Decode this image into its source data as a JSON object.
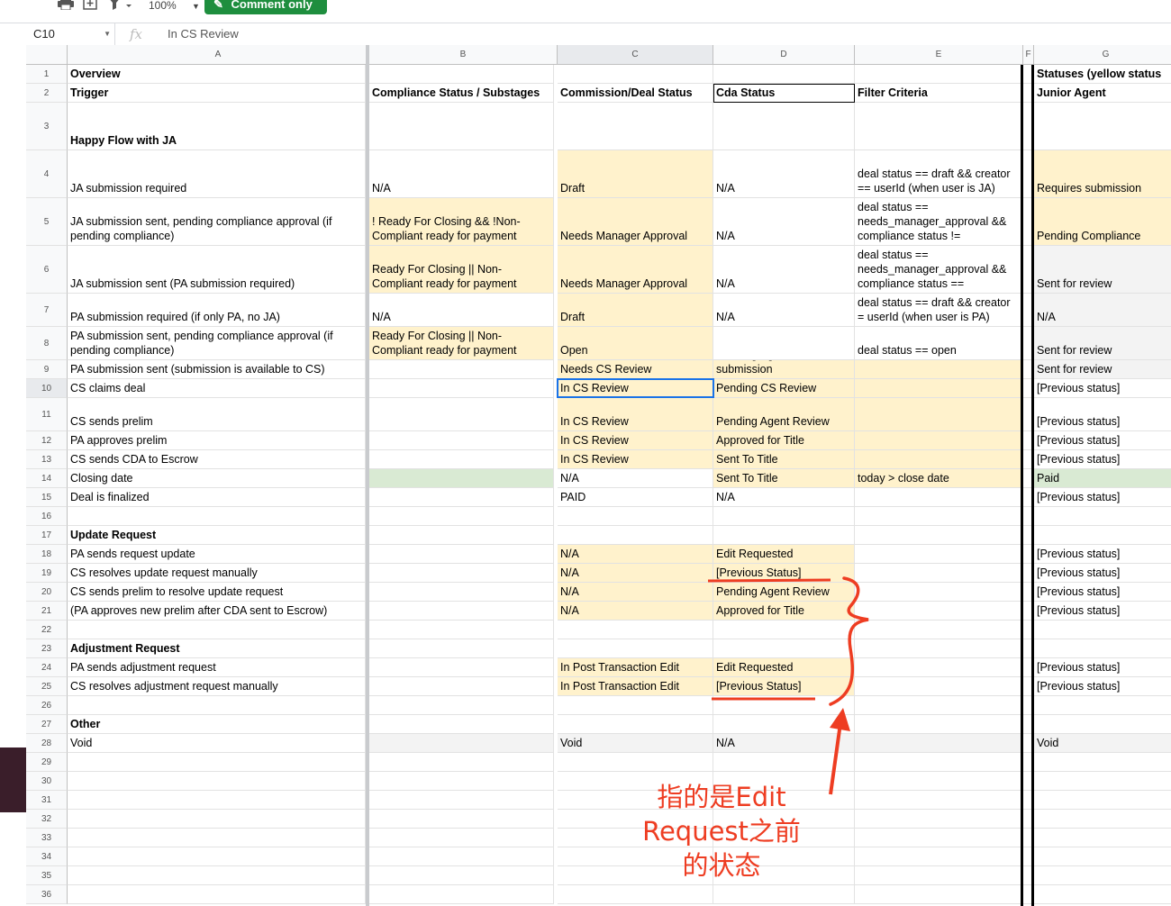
{
  "toolbar": {
    "zoom": "100%",
    "comment_button": "Comment only",
    "icons": [
      "print-icon",
      "add-icon",
      "filter-icon"
    ]
  },
  "formula_bar": {
    "cell_ref": "C10",
    "fx": "fx",
    "value": "In CS Review"
  },
  "columns": [
    "A",
    "B",
    "C",
    "D",
    "E",
    "F",
    "G"
  ],
  "rows": [
    {
      "n": "1",
      "A": "Overview",
      "G": "Statuses (yellow status"
    },
    {
      "n": "2",
      "A": "Trigger",
      "B": "Compliance Status / Substages",
      "C": "Commission/Deal Status",
      "D": "Cda Status",
      "E": "Filter Criteria",
      "G": "Junior Agent"
    },
    {
      "n": "3",
      "A": "Happy Flow with JA"
    },
    {
      "n": "4",
      "A": "JA submission required",
      "B": "N/A",
      "C": "Draft",
      "D": "N/A",
      "E": "deal status == draft && creator == userId (when user is JA)",
      "G": "Requires submission"
    },
    {
      "n": "5",
      "A": "JA submission sent, pending compliance approval (if pending compliance)",
      "B": "! Ready For Closing && !Non-Compliant ready for payment",
      "C": "Needs Manager Approval",
      "D": "N/A",
      "E": "deal status == needs_manager_approval && compliance status !=",
      "G": "Pending Compliance"
    },
    {
      "n": "6",
      "A": "JA submission sent (PA submission required)",
      "B": "Ready For Closing || Non-Compliant ready for payment",
      "C": "Needs Manager Approval",
      "D": "N/A",
      "E": "deal status == needs_manager_approval && compliance status ==",
      "G": "Sent for review"
    },
    {
      "n": "7",
      "A": "PA submission required (if only PA, no JA)",
      "B": "N/A",
      "C": "Draft",
      "D": "N/A",
      "E": "deal status == draft && creator = userId (when user is PA)",
      "G": "N/A"
    },
    {
      "n": "8",
      "A": "PA submission sent, pending compliance approval (if pending compliance)",
      "B": "Ready For Closing || Non-Compliant ready for payment",
      "C": "Open",
      "D": "",
      "E": "deal status == open",
      "G": "Sent for review"
    },
    {
      "n": "9",
      "A": "PA submission sent (submission is available to CS)",
      "C": "Needs CS Review",
      "D": "Pending Agent final submission",
      "G": "Sent for review"
    },
    {
      "n": "10",
      "A": "CS claims deal",
      "C": "In CS Review",
      "D": "Pending CS Review",
      "G": "[Previous status]"
    },
    {
      "n": "11",
      "A": "CS sends prelim",
      "C": "In CS Review",
      "D": "Pending Agent Review",
      "G": "[Previous status]"
    },
    {
      "n": "12",
      "A": "PA approves prelim",
      "C": "In CS Review",
      "D": "Approved for Title",
      "G": "[Previous status]"
    },
    {
      "n": "13",
      "A": "CS sends CDA to Escrow",
      "C": "In CS Review",
      "D": "Sent To Title",
      "G": "[Previous status]"
    },
    {
      "n": "14",
      "A": "Closing date",
      "C": "N/A",
      "D": "Sent To Title",
      "E": "today > close date",
      "G": "Paid"
    },
    {
      "n": "15",
      "A": "Deal is finalized",
      "C": "PAID",
      "D": "N/A",
      "G": "[Previous status]"
    },
    {
      "n": "16"
    },
    {
      "n": "17",
      "A": "Update Request"
    },
    {
      "n": "18",
      "A": "PA sends request update",
      "C": "N/A",
      "D": "Edit Requested",
      "G": "[Previous status]"
    },
    {
      "n": "19",
      "A": "CS resolves update request manually",
      "C": "N/A",
      "D": "[Previous Status]",
      "G": "[Previous status]"
    },
    {
      "n": "20",
      "A": "CS sends prelim to resolve update request",
      "C": "N/A",
      "D": "Pending Agent Review",
      "G": "[Previous status]"
    },
    {
      "n": "21",
      "A": "(PA approves new prelim after CDA sent to Escrow)",
      "C": "N/A",
      "D": "Approved for Title",
      "G": "[Previous status]"
    },
    {
      "n": "22"
    },
    {
      "n": "23",
      "A": "Adjustment Request"
    },
    {
      "n": "24",
      "A": "PA sends adjustment request",
      "C": "In Post Transaction Edit",
      "D": "Edit Requested",
      "G": "[Previous status]"
    },
    {
      "n": "25",
      "A": "CS resolves adjustment request manually",
      "C": "In Post Transaction Edit",
      "D": "[Previous Status]",
      "G": "[Previous status]"
    },
    {
      "n": "26"
    },
    {
      "n": "27",
      "A": "Other"
    },
    {
      "n": "28",
      "A": "Void",
      "C": "Void",
      "D": "N/A",
      "G": "Void"
    },
    {
      "n": "29"
    },
    {
      "n": "30"
    },
    {
      "n": "31"
    },
    {
      "n": "32"
    },
    {
      "n": "33"
    },
    {
      "n": "34"
    },
    {
      "n": "35"
    },
    {
      "n": "36"
    }
  ],
  "annotation": {
    "text_lines": [
      "指的是Edit",
      "Request之前",
      "的状态"
    ],
    "color": "#ee3d22"
  },
  "colors": {
    "yellow_fill": "#fff2cc",
    "green_fill": "#d9ead3",
    "grey_fill": "#f3f3f3",
    "selection": "#1a73e8",
    "comment_button": "#1e8e3e"
  }
}
